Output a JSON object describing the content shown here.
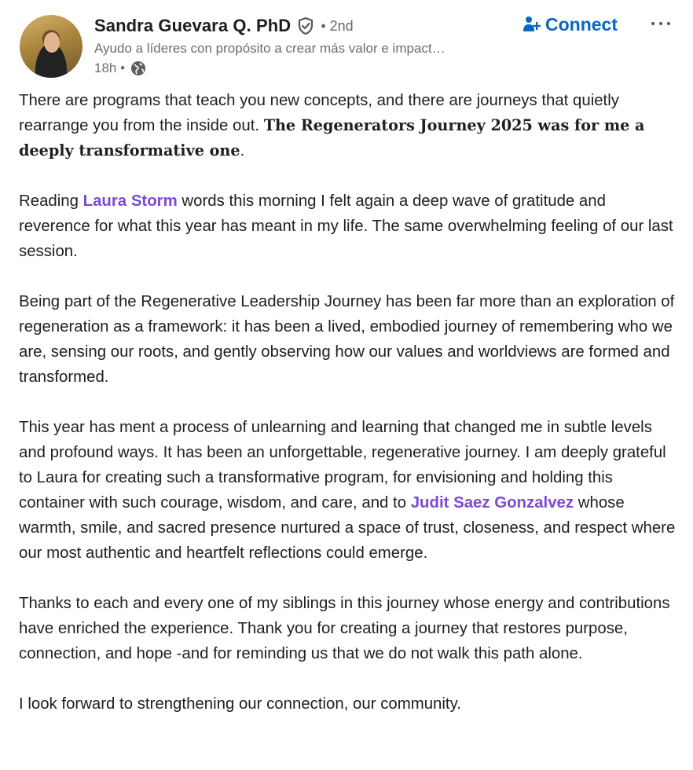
{
  "author": {
    "name": "Sandra Guevara Q. PhD",
    "degree": "• 2nd",
    "headline": "Ayudo a líderes con propósito a crear más valor e impact…",
    "time": "18h •",
    "icons": {
      "verified": "shield-check-icon",
      "visibility": "globe-icon",
      "avatar": "profile-photo"
    }
  },
  "actions": {
    "connect_label": "Connect",
    "more_label": "···"
  },
  "colors": {
    "accent": "#0a66c2",
    "mention": "#7c4ad0",
    "text": "#202020",
    "muted": "#6d6d6d"
  },
  "post": {
    "p1_a": "There are programs that teach you new concepts, and there are journeys that quietly rearrange you from the inside out. ",
    "p1_bold": "The Regenerators Journey 2025 was for me a deeply transformative one",
    "p1_end": ".",
    "p2_a": "Reading ",
    "p2_mention": "Laura Storm",
    "p2_b": " words this morning I felt again a deep wave of gratitude and reverence for what this year has meant in my life. The same overwhelming feeling of our last session.",
    "p3": "Being part of the Regenerative Leadership Journey has been far more than an exploration of regeneration as a framework: it has been a lived, embodied journey of remembering who we are, sensing our roots, and gently observing how our values and worldviews are formed and transformed.",
    "p4_a": "This year has ment a process of unlearning and learning that changed me in subtle levels and profound ways. It has been an unforgettable, regenerative journey. I am deeply grateful to Laura for creating such a transformative program, for envisioning and holding this container with such courage, wisdom, and care, and to ",
    "p4_mention": "Judit Saez Gonzalvez",
    "p4_b": " whose warmth, smile, and sacred presence nurtured a space of trust, closeness, and respect where our most authentic and heartfelt reflections could emerge.",
    "p5": "Thanks to each and every one of my siblings in this journey whose energy and contributions have enriched the experience. Thank you for creating a journey that restores purpose, connection, and hope -and for reminding us that we do not walk this path alone.",
    "p6": "I look forward to strengthening our connection, our community."
  }
}
